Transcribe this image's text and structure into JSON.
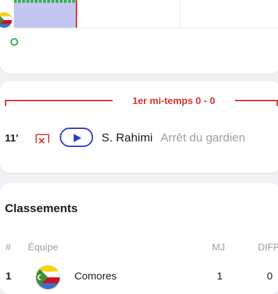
{
  "timeline": {
    "period_label": "1er mi-temps 0 - 0",
    "event": {
      "minute": "11'",
      "player": "S. Rahimi",
      "action": "Arrêt du gardien"
    }
  },
  "standings": {
    "title": "Classements",
    "headers": {
      "rank": "#",
      "team": "Équipe",
      "played": "MJ",
      "diff": "DIFF"
    },
    "rows": [
      {
        "rank": "1",
        "team": "Comores",
        "played": "1",
        "diff": "0"
      }
    ]
  },
  "colors": {
    "accent_red": "#d9302a",
    "accent_blue": "#2a3bd8",
    "momentum_fill": "#c3c6ef",
    "momentum_green": "#32b34a"
  }
}
